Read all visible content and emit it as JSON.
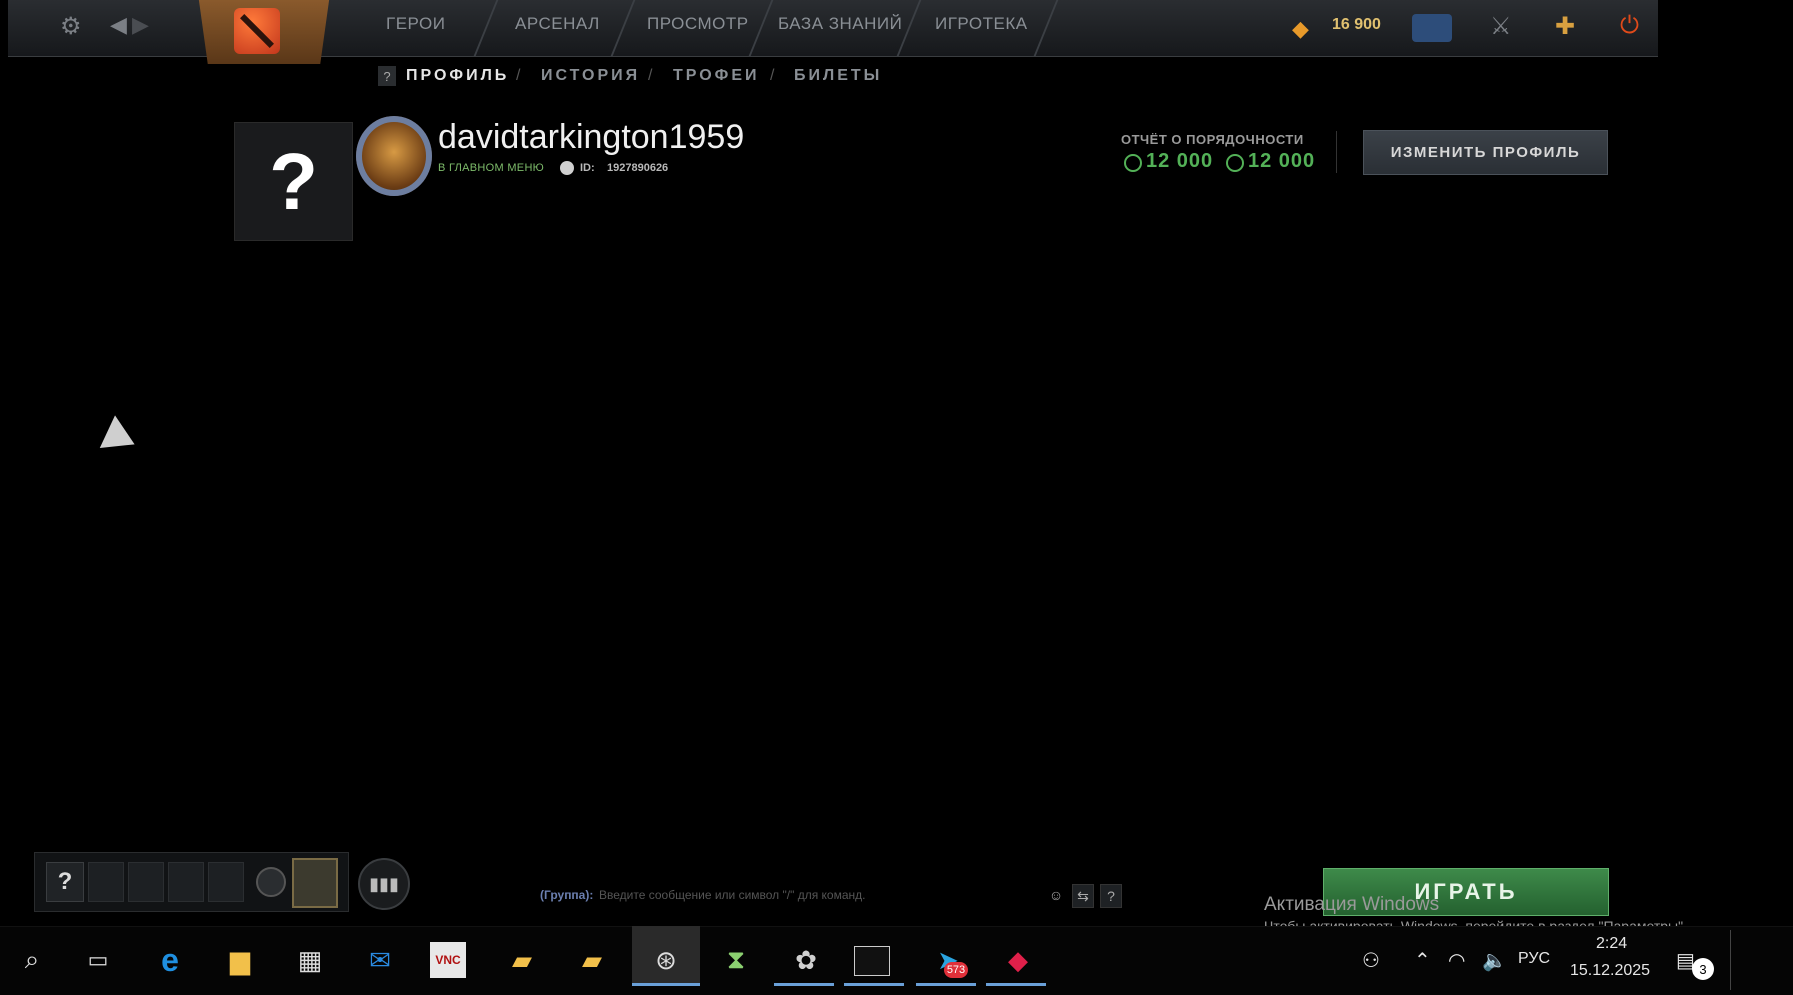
{
  "nav": {
    "links": [
      "ГЕРОИ",
      "АРСЕНАЛ",
      "ПРОСМОТР",
      "БАЗА ЗНАНИЙ",
      "ИГРОТЕКА"
    ],
    "shards": "16 900"
  },
  "subnav": {
    "help": "?",
    "tabs": [
      "ПРОФИЛЬ",
      "ИСТОРИЯ",
      "ТРОФЕИ",
      "БИЛЕТЫ"
    ],
    "separator": "/"
  },
  "profile": {
    "avatar_placeholder": "?",
    "username": "davidtarkington1959",
    "status": "В ГЛАВНОМ МЕНЮ",
    "id_label": "ID:",
    "id_value": "1927890626",
    "behavior_label": "ОТЧЁТ О ПОРЯДОЧНОСТИ",
    "behavior_score": "12 000",
    "communication_score": "12 000",
    "edit_button": "ИЗМЕНИТЬ ПРОФИЛЬ"
  },
  "party": {
    "help": "?"
  },
  "chat": {
    "channel": "(Группа):",
    "placeholder": "Введите сообщение или символ \"/\" для команд."
  },
  "play_button": "ИГРАТЬ",
  "watermark": {
    "title": "Активация Windows",
    "text": "Чтобы активировать Windows, перейдите в раздел \"Параметры\"."
  },
  "taskbar": {
    "telegram_badge": "573",
    "language": "РУС",
    "time": "2:24",
    "date": "15.12.2025",
    "notifications": "3"
  },
  "colors": {
    "accent_green": "#53b157",
    "play_green": "#2f7a3b",
    "nav_bg": "#1f2226"
  }
}
